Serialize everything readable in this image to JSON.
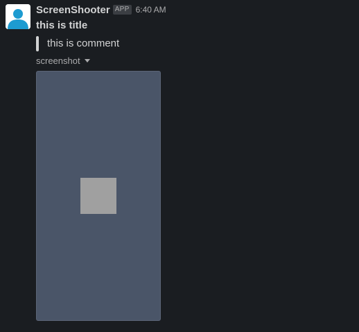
{
  "message": {
    "sender": "ScreenShooter",
    "badge": "APP",
    "timestamp": "6:40 AM",
    "title": "this is title",
    "comment": "this is comment",
    "attachment_label": "screenshot",
    "avatar_icon": "user-avatar-icon",
    "caret_icon": "caret-down-icon",
    "colors": {
      "background": "#1a1d21",
      "avatar": "#1d9bd1",
      "image_background": "#4a5568",
      "image_square": "#a0a0a0"
    }
  }
}
